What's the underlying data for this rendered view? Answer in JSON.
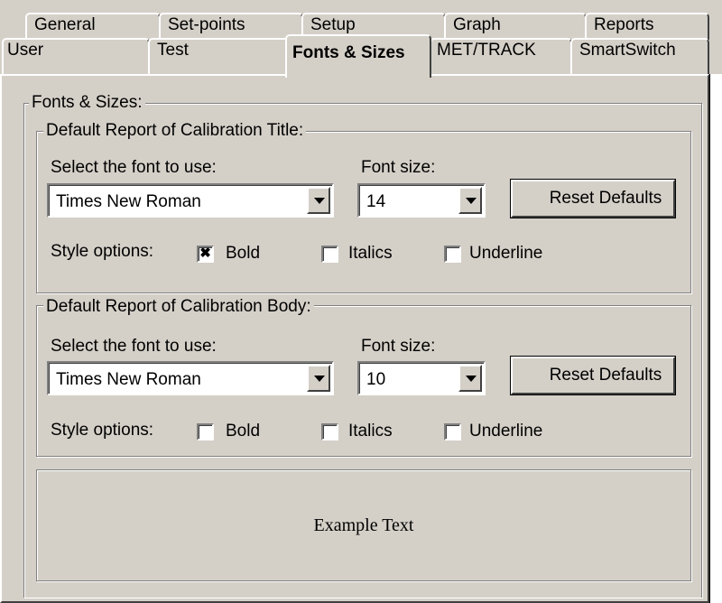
{
  "tabs_row1": [
    {
      "label": "General"
    },
    {
      "label": "Set-points"
    },
    {
      "label": "Setup"
    },
    {
      "label": "Graph"
    },
    {
      "label": "Reports"
    }
  ],
  "tabs_row2": [
    {
      "label": "User"
    },
    {
      "label": "Test"
    },
    {
      "label": "Fonts & Sizes",
      "selected": true
    },
    {
      "label": "MET/TRACK"
    },
    {
      "label": "SmartSwitch"
    }
  ],
  "fonts_group": {
    "title": "Fonts & Sizes:"
  },
  "title_group": {
    "title": "Default Report of Calibration Title:",
    "font_label": "Select the font to use:",
    "font_value": "Times New Roman",
    "size_label": "Font size:",
    "size_value": "14",
    "reset_label": "Reset Defaults",
    "style_label": "Style options:",
    "bold_label": "Bold",
    "bold_checked": true,
    "bold_mark": "✖",
    "italics_label": "Italics",
    "italics_checked": false,
    "underline_label": "Underline",
    "underline_checked": false
  },
  "body_group": {
    "title": "Default Report of Calibration Body:",
    "font_label": "Select the font to use:",
    "font_value": "Times New Roman",
    "size_label": "Font size:",
    "size_value": "10",
    "reset_label": "Reset Defaults",
    "style_label": "Style options:",
    "bold_label": "Bold",
    "bold_checked": false,
    "italics_label": "Italics",
    "italics_checked": false,
    "underline_label": "Underline",
    "underline_checked": false
  },
  "example": {
    "text": "Example Text"
  }
}
